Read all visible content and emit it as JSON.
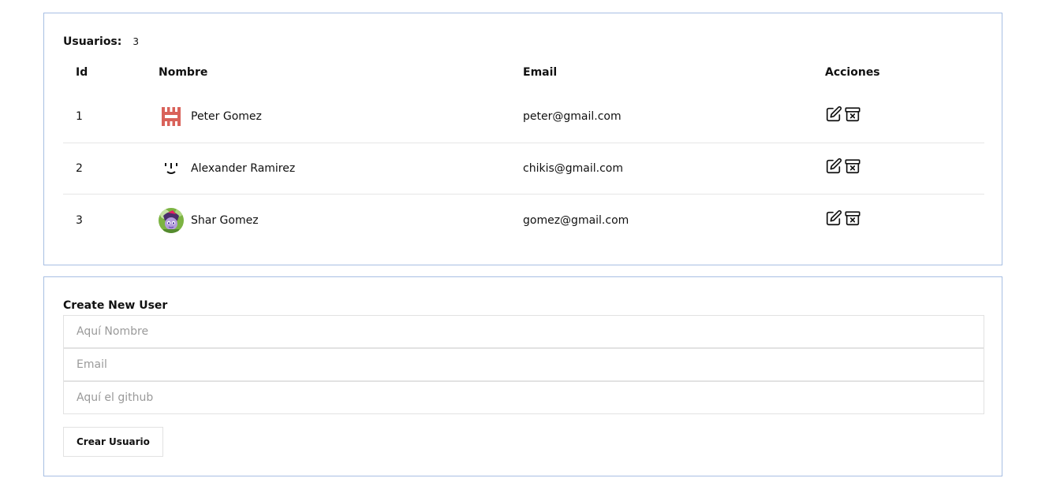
{
  "users_panel": {
    "label": "Usuarios:",
    "count": "3",
    "columns": [
      "Id",
      "Nombre",
      "Email",
      "Acciones"
    ],
    "rows": [
      {
        "id": "1",
        "name": "Peter Gomez",
        "email": "peter@gmail.com",
        "avatar": "pixel-castle-avatar"
      },
      {
        "id": "2",
        "name": "Alexander Ramirez",
        "email": "chikis@gmail.com",
        "avatar": "face-glyph-avatar"
      },
      {
        "id": "3",
        "name": "Shar Gomez",
        "email": "gomez@gmail.com",
        "avatar": "cartoon-pony-avatar"
      }
    ],
    "action_icons": [
      "edit-icon",
      "archive-delete-icon"
    ]
  },
  "create_panel": {
    "title": "Create New User",
    "name_placeholder": "Aquí Nombre",
    "email_placeholder": "Email",
    "github_placeholder": "Aquí el github",
    "submit_label": "Crear Usuario"
  },
  "colors": {
    "card_border": "#a8bfe3",
    "row_divider": "#e6e6e6",
    "avatar_red": "#d9625a"
  }
}
